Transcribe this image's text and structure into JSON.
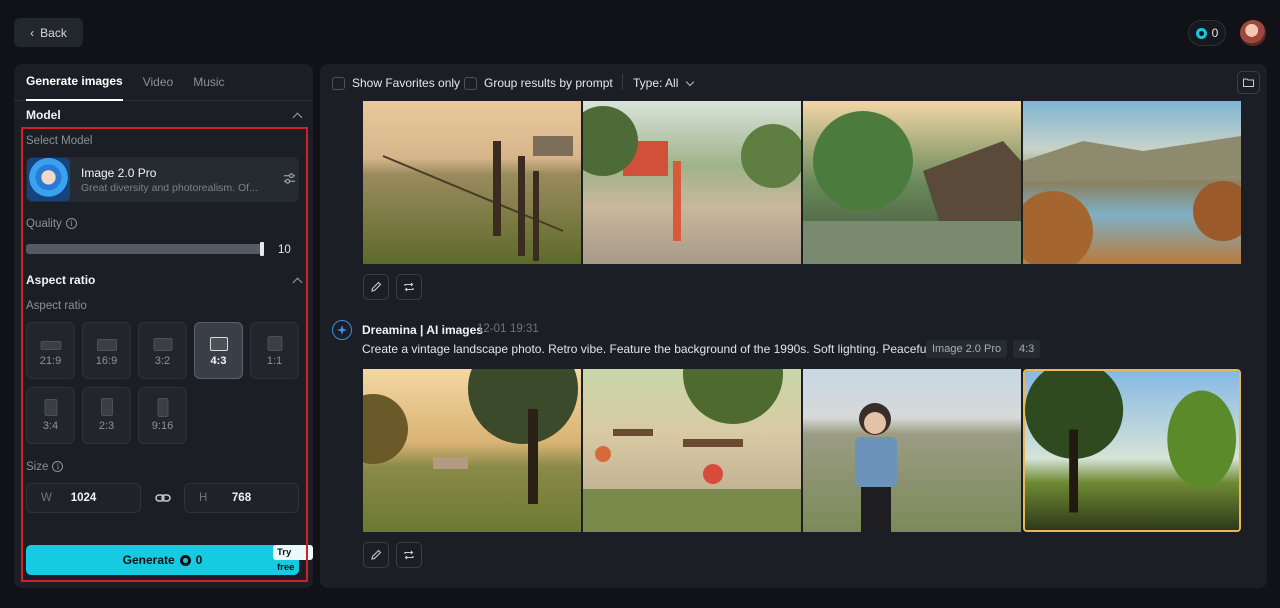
{
  "topbar": {
    "back_label": "Back",
    "credits": "0"
  },
  "left": {
    "tabs": [
      "Generate images",
      "Video",
      "Music"
    ],
    "model_section_title": "Model",
    "select_model_label": "Select Model",
    "model_name": "Image 2.0 Pro",
    "model_desc": "Great diversity and photorealism. Of...",
    "quality_label": "Quality",
    "quality_value": "10",
    "aspect_section_title": "Aspect ratio",
    "aspect_label": "Aspect ratio",
    "ratios": [
      "21:9",
      "16:9",
      "3:2",
      "4:3",
      "1:1",
      "3:4",
      "2:3",
      "9:16"
    ],
    "selected_ratio": "4:3",
    "size_label": "Size",
    "width_key": "W",
    "width_value": "1024",
    "height_key": "H",
    "height_value": "768",
    "generate_label": "Generate",
    "generate_cost": "0",
    "try_free": "Try free"
  },
  "right": {
    "filters": {
      "favorites": "Show Favorites only",
      "group": "Group results by prompt",
      "type": "Type: All"
    },
    "result": {
      "author": "Dreamina | AI images",
      "date": "12-01",
      "time": "19:31",
      "prompt": "Create a vintage landscape photo. Retro vibe. Feature the background of the 1990s. Soft lighting. Peaceful vibe.",
      "model_tag": "Image 2.0 Pro",
      "ratio_tag": "4:3"
    }
  },
  "icons": {
    "back": "chevron-left-icon",
    "credit": "coin-icon",
    "tune": "sliders-icon",
    "link": "link-icon",
    "folder": "folder-icon",
    "edit": "pencil-icon",
    "regenerate": "repeat-icon",
    "dreamina": "dreamina-logo-icon"
  },
  "colors": {
    "accent": "#16cbe1",
    "highlight_frame": "#d32027",
    "background": "#101217",
    "panel": "#1b1e24"
  }
}
